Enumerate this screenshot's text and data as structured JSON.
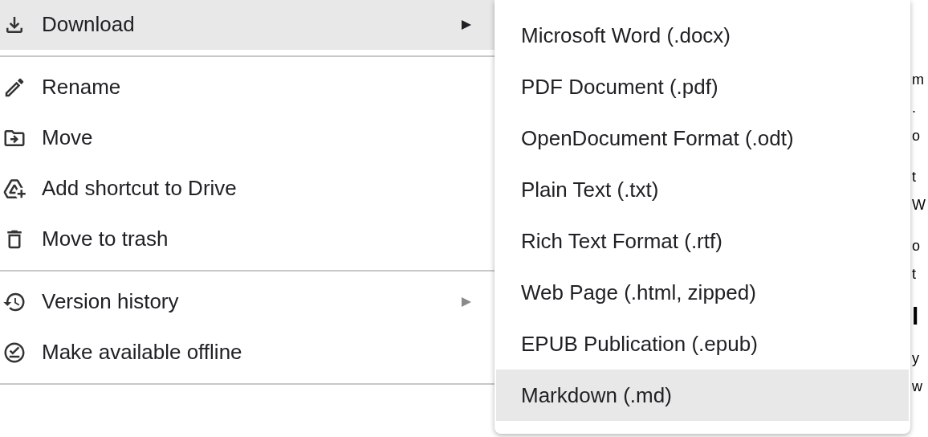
{
  "menu": {
    "items": [
      {
        "kind": "item",
        "label": "Download",
        "selected": true,
        "has_submenu": true
      },
      {
        "kind": "divider"
      },
      {
        "kind": "item",
        "label": "Rename",
        "selected": false,
        "has_submenu": false
      },
      {
        "kind": "item",
        "label": "Move",
        "selected": false,
        "has_submenu": false
      },
      {
        "kind": "item",
        "label": "Add shortcut to Drive",
        "selected": false,
        "has_submenu": false
      },
      {
        "kind": "item",
        "label": "Move to trash",
        "selected": false,
        "has_submenu": false
      },
      {
        "kind": "divider"
      },
      {
        "kind": "item",
        "label": "Version history",
        "selected": false,
        "has_submenu": true
      },
      {
        "kind": "item",
        "label": "Make available offline",
        "selected": false,
        "has_submenu": false
      },
      {
        "kind": "divider"
      }
    ]
  },
  "submenu": {
    "items": [
      {
        "label": "Microsoft Word (.docx)",
        "selected": false
      },
      {
        "label": "PDF Document (.pdf)",
        "selected": false
      },
      {
        "label": "OpenDocument Format (.odt)",
        "selected": false
      },
      {
        "label": "Plain Text (.txt)",
        "selected": false
      },
      {
        "label": "Rich Text Format (.rtf)",
        "selected": false
      },
      {
        "label": "Web Page (.html, zipped)",
        "selected": false
      },
      {
        "label": "EPUB Publication (.epub)",
        "selected": false
      },
      {
        "label": "Markdown (.md)",
        "selected": true
      }
    ]
  },
  "document": {
    "lines": [
      {
        "kind": "text",
        "text": "m"
      },
      {
        "kind": "text",
        "text": "."
      },
      {
        "kind": "text",
        "text": "o"
      },
      {
        "kind": "gap"
      },
      {
        "kind": "text",
        "text": "t"
      },
      {
        "kind": "text",
        "text": "W"
      },
      {
        "kind": "gap"
      },
      {
        "kind": "text",
        "text": "o"
      },
      {
        "kind": "text",
        "text": "t"
      },
      {
        "kind": "heading",
        "text": "l"
      },
      {
        "kind": "text",
        "text": "y"
      },
      {
        "kind": "text",
        "text": "w"
      }
    ]
  }
}
